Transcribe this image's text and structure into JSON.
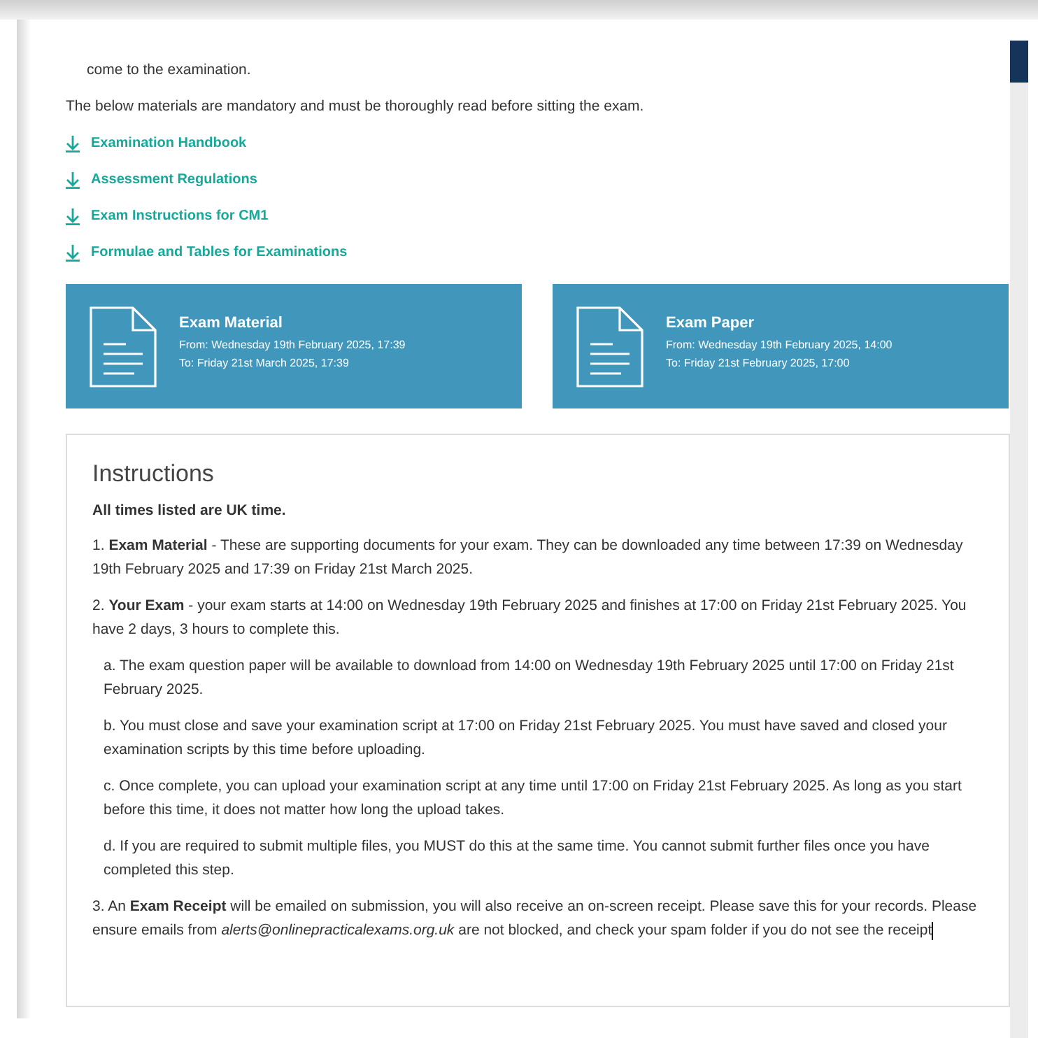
{
  "intro": [
    "come to the examination.",
    "The below materials are mandatory and must be thoroughly read before sitting the exam."
  ],
  "links": [
    {
      "label": "Examination Handbook"
    },
    {
      "label": "Assessment Regulations"
    },
    {
      "label": "Exam Instructions for CM1"
    },
    {
      "label": "Formulae and Tables for Examinations"
    }
  ],
  "cards": [
    {
      "title": "Exam Material",
      "from": "From: Wednesday 19th February 2025, 17:39",
      "to": "To: Friday 21st March 2025, 17:39"
    },
    {
      "title": "Exam Paper",
      "from": "From: Wednesday 19th February 2025, 14:00",
      "to": "To: Friday 21st February 2025, 17:00"
    }
  ],
  "instructions": {
    "title": "Instructions",
    "note": "All times listed are UK time.",
    "items": [
      {
        "text": "1. **Exam Material** - These are supporting documents for your exam. They can be downloaded any time between 17:39 on Wednesday 19th February 2025 and 17:39 on Friday 21st March 2025."
      },
      {
        "text": "2. **Your Exam** - your exam starts at 14:00 on Wednesday 19th February 2025 and finishes at 17:00 on Friday 21st February 2025. You have 2 days, 3 hours to complete this.",
        "children": [
          {
            "text": "a. The exam question paper will be available to download from 14:00 on Wednesday 19th February 2025 until 17:00 on Friday 21st February 2025."
          },
          {
            "text": "b. You must close and save your examination script at 17:00 on Friday 21st February 2025. You must have saved and closed your examination scripts by this time before uploading."
          },
          {
            "text": "c. Once complete, you can upload your examination script at any time until 17:00 on Friday 21st February 2025. As long as you start before this time, it does not matter how long the upload takes."
          },
          {
            "text": "d. If you are required to submit multiple files, you MUST do this at the same time. You cannot submit further files once you have completed this step."
          }
        ]
      },
      {
        "text": "3. An **Exam Receipt** will be emailed on submission, you will also receive an on-screen receipt. Please save this for your records. Please ensure emails from *alerts@onlinepracticalexams.org.uk* are not blocked, and check your spam folder if you do not see the receipt"
      }
    ]
  }
}
